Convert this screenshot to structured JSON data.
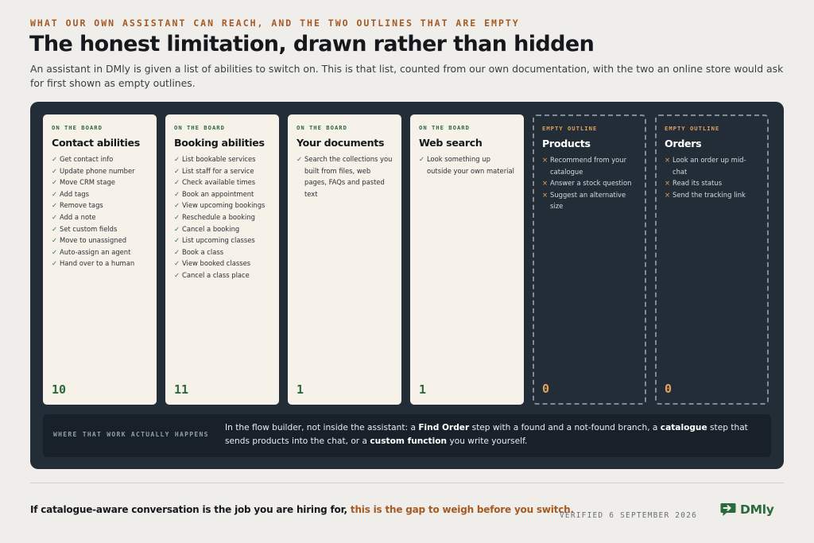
{
  "eyebrow": "WHAT OUR OWN ASSISTANT CAN REACH, AND THE TWO OUTLINES THAT ARE EMPTY",
  "title": "The honest limitation, drawn rather than hidden",
  "lede": "An assistant in DMly is given a list of abilities to switch on. This is that list, counted from our own documentation, with the two an online store would ask for first shown as empty outlines.",
  "cards": [
    {
      "tag": "ON THE BOARD",
      "title": "Contact abilities",
      "items": [
        "Get contact info",
        "Update phone number",
        "Move CRM stage",
        "Add tags",
        "Remove tags",
        "Add a note",
        "Set custom fields",
        "Move to unassigned",
        "Auto-assign an agent",
        "Hand over to a human"
      ],
      "count": "10"
    },
    {
      "tag": "ON THE BOARD",
      "title": "Booking abilities",
      "items": [
        "List bookable services",
        "List staff for a service",
        "Check available times",
        "Book an appointment",
        "View upcoming bookings",
        "Reschedule a booking",
        "Cancel a booking",
        "List upcoming classes",
        "Book a class",
        "View booked classes",
        "Cancel a class place"
      ],
      "count": "11"
    },
    {
      "tag": "ON THE BOARD",
      "title": "Your documents",
      "items": [
        "Search the collections you built from files, web pages, FAQs and pasted text"
      ],
      "count": "1"
    },
    {
      "tag": "ON THE BOARD",
      "title": "Web search",
      "items": [
        "Look something up outside your own material"
      ],
      "count": "1"
    },
    {
      "tag": "EMPTY OUTLINE",
      "title": "Products",
      "items": [
        "Recommend from your catalogue",
        "Answer a stock question",
        "Suggest an alternative size"
      ],
      "count": "0"
    },
    {
      "tag": "EMPTY OUTLINE",
      "title": "Orders",
      "items": [
        "Look an order up mid-chat",
        "Read its status",
        "Send the tracking link"
      ],
      "count": "0"
    }
  ],
  "marks": {
    "check": "✓",
    "cross": "×"
  },
  "where": {
    "label": "WHERE THAT WORK ACTUALLY HAPPENS",
    "t1": "In the flow builder, not inside the assistant: a ",
    "b1": "Find Order",
    "t2": " step with a found and a not-found branch, a ",
    "b2": "catalogue",
    "t3": " step that sends products into the chat, or a ",
    "b3": "custom function",
    "t4": " you write yourself."
  },
  "footer": {
    "text": "If catalogue-aware conversation is the job you are hiring for, ",
    "accent": "this is the gap to weigh before you switch.",
    "verified": "VERIFIED 6 SEPTEMBER 2026",
    "brand": "DMly"
  },
  "colors": {
    "accent": "#a55a24",
    "green": "#2a6a3b",
    "board": "#232d37",
    "empty_accent": "#e6a15b"
  }
}
